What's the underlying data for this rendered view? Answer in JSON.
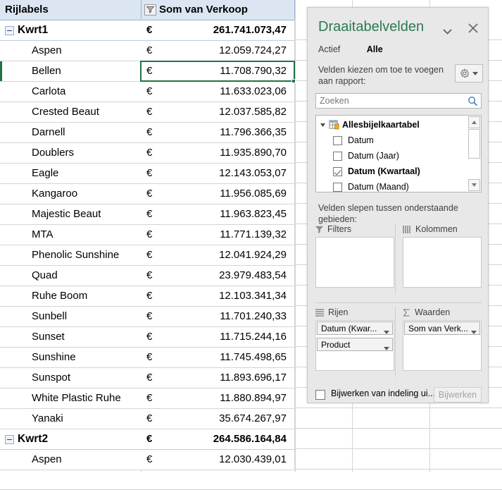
{
  "sheet": {
    "header": {
      "row_labels": "Rijlabels",
      "value_header": "Som van Verkoop",
      "filter_icon": "filter-dropdown-icon"
    },
    "currency": "€",
    "rows": [
      {
        "level": 0,
        "label": "Kwrt1",
        "currency": "€",
        "value": "261.741.073,47"
      },
      {
        "level": 1,
        "label": "Aspen",
        "currency": "€",
        "value": "12.059.724,27"
      },
      {
        "level": 1,
        "label": "Bellen",
        "currency": "€",
        "value": "11.708.790,32"
      },
      {
        "level": 1,
        "label": "Carlota",
        "currency": "€",
        "value": "11.633.023,06"
      },
      {
        "level": 1,
        "label": "Crested Beaut",
        "currency": "€",
        "value": "12.037.585,82"
      },
      {
        "level": 1,
        "label": "Darnell",
        "currency": "€",
        "value": "11.796.366,35"
      },
      {
        "level": 1,
        "label": "Doublers",
        "currency": "€",
        "value": "11.935.890,70"
      },
      {
        "level": 1,
        "label": "Eagle",
        "currency": "€",
        "value": "12.143.053,07"
      },
      {
        "level": 1,
        "label": "Kangaroo",
        "currency": "€",
        "value": "11.956.085,69"
      },
      {
        "level": 1,
        "label": "Majestic Beaut",
        "currency": "€",
        "value": "11.963.823,45"
      },
      {
        "level": 1,
        "label": "MTA",
        "currency": "€",
        "value": "11.771.139,32"
      },
      {
        "level": 1,
        "label": "Phenolic Sunshine",
        "currency": "€",
        "value": "12.041.924,29"
      },
      {
        "level": 1,
        "label": "Quad",
        "currency": "€",
        "value": "23.979.483,54"
      },
      {
        "level": 1,
        "label": "Ruhe Boom",
        "currency": "€",
        "value": "12.103.341,34"
      },
      {
        "level": 1,
        "label": "Sunbell",
        "currency": "€",
        "value": "11.701.240,33"
      },
      {
        "level": 1,
        "label": "Sunset",
        "currency": "€",
        "value": "11.715.244,16"
      },
      {
        "level": 1,
        "label": "Sunshine",
        "currency": "€",
        "value": "11.745.498,65"
      },
      {
        "level": 1,
        "label": "Sunspot",
        "currency": "€",
        "value": "11.893.696,17"
      },
      {
        "level": 1,
        "label": "White Plastic Ruhe",
        "currency": "€",
        "value": "11.880.894,97"
      },
      {
        "level": 1,
        "label": "Yanaki",
        "currency": "€",
        "value": "35.674.267,97"
      },
      {
        "level": 0,
        "label": "Kwrt2",
        "currency": "€",
        "value": "264.586.164,84"
      },
      {
        "level": 1,
        "label": "Aspen",
        "currency": "€",
        "value": "12.030.439,01"
      }
    ],
    "selected_cell_row_label": "Bellen",
    "selection_color": "#217346"
  },
  "panel": {
    "title": "Draaitabelvelden",
    "title_color": "#2b7a53",
    "caret_icon": "chevron-down-icon",
    "close_icon": "close-icon",
    "tabs": [
      {
        "label": "Actief",
        "active": false
      },
      {
        "label": "Alle",
        "active": true
      }
    ],
    "choose_hint": "Velden kiezen om toe te voegen aan rapport:",
    "gear_icon": "gear-icon",
    "gear_caret_icon": "chevron-down-icon",
    "search": {
      "placeholder": "Zoeken",
      "value": "",
      "icon": "search-icon"
    },
    "field_list": {
      "table_name": "Allesbijelkaartabel",
      "table_icon": "pivot-table-icon",
      "expand_icon": "triangle-collapse-icon",
      "fields": [
        {
          "label": "Datum",
          "checked": false
        },
        {
          "label": "Datum (Jaar)",
          "checked": false
        },
        {
          "label": "Datum (Kwartaal)",
          "checked": true
        },
        {
          "label": "Datum (Maand)",
          "checked": false
        }
      ],
      "scrollbar": {
        "up_icon": "scroll-up-icon",
        "down_icon": "scroll-down-icon"
      }
    },
    "drag_hint": "Velden slepen tussen onderstaande gebieden:",
    "zones": [
      {
        "name": "Filters",
        "icon": "filter-icon",
        "chips": []
      },
      {
        "name": "Kolommen",
        "icon": "columns-icon",
        "chips": []
      },
      {
        "name": "Rijen",
        "icon": "rows-icon",
        "chips": [
          "Datum (Kwar...",
          "Product"
        ]
      },
      {
        "name": "Waarden",
        "icon": "sigma-icon",
        "chips": [
          "Som van Verk..."
        ]
      }
    ],
    "defer": {
      "checkbox_label": "Bijwerken van indeling ui...",
      "checked": false,
      "button_label": "Bijwerken"
    }
  }
}
